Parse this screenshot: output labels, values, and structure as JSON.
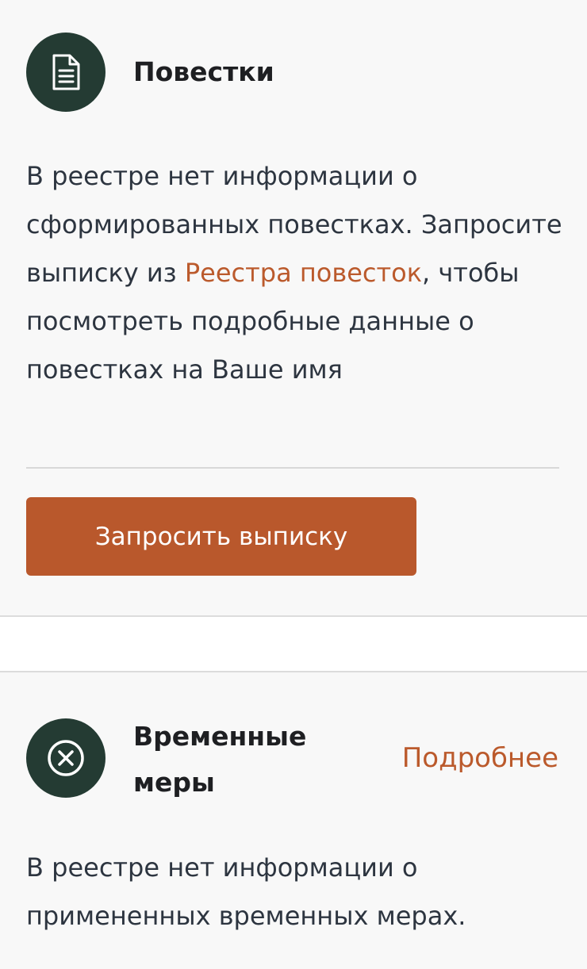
{
  "summons": {
    "icon": "document-icon",
    "title": "Повестки",
    "text_part1": "В реестре нет информации о сформированных повестках. Запросите выписку из ",
    "link_text": "Реестра повесток",
    "text_part2": ", чтобы посмотреть подробные данные о повестках на Ваше имя",
    "button_label": "Запросить выписку"
  },
  "temporary_measures": {
    "icon": "close-circle-icon",
    "title_line1": "Временные",
    "title_line2": "меры",
    "more_link": "Подробнее",
    "text": "В реестре нет информации о примененных временных мерах."
  },
  "colors": {
    "accent": "#b9582c",
    "link": "#bb5a2c",
    "icon_background": "#243b33",
    "card_background": "#f8f8f8"
  }
}
